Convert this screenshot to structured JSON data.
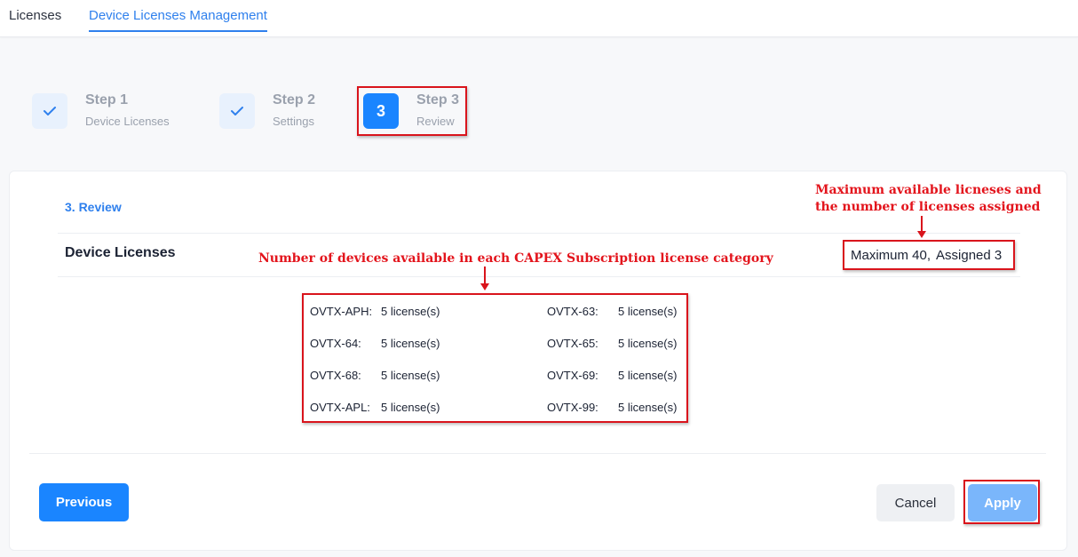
{
  "tabs": [
    {
      "label": "Licenses"
    },
    {
      "label": "Device Licenses Management"
    }
  ],
  "steps": [
    {
      "title": "Step 1",
      "subtitle": "Device Licenses"
    },
    {
      "title": "Step 2",
      "subtitle": "Settings"
    },
    {
      "number": "3",
      "title": "Step 3",
      "subtitle": "Review"
    }
  ],
  "review": {
    "section_label": "3. Review",
    "device_licenses_label": "Device Licenses",
    "maximum": "Maximum 40,",
    "assigned": "Assigned 3"
  },
  "licenses": [
    {
      "name": "OVTX-APH:",
      "value": "5 license(s)"
    },
    {
      "name": "OVTX-63:",
      "value": "5 license(s)"
    },
    {
      "name": "OVTX-64:",
      "value": "5 license(s)"
    },
    {
      "name": "OVTX-65:",
      "value": "5 license(s)"
    },
    {
      "name": "OVTX-68:",
      "value": "5 license(s)"
    },
    {
      "name": "OVTX-69:",
      "value": "5 license(s)"
    },
    {
      "name": "OVTX-APL:",
      "value": "5 license(s)"
    },
    {
      "name": "OVTX-99:",
      "value": "5 license(s)"
    }
  ],
  "annotations": {
    "max_line1": "Maximum available licneses and",
    "max_line2": "the number of licenses assigned",
    "devices": "Number of devices available in each CAPEX Subscription license category"
  },
  "buttons": {
    "previous": "Previous",
    "cancel": "Cancel",
    "apply": "Apply"
  },
  "colors": {
    "primary": "#1a85ff",
    "annotation_red": "#e3141c",
    "apply_disabled": "#7ab6fb"
  }
}
